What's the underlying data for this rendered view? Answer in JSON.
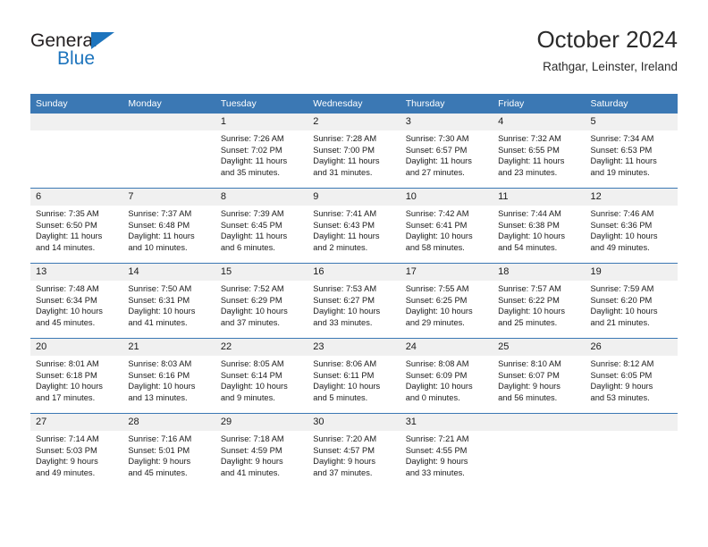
{
  "brand": {
    "name_top": "General",
    "name_bottom": "Blue",
    "accent_color": "#1d74bd"
  },
  "header": {
    "title": "October 2024",
    "subtitle": "Rathgar, Leinster, Ireland"
  },
  "calendar": {
    "header_bg": "#3b78b4",
    "daynum_bg": "#f0f0f0",
    "weekdays": [
      "Sunday",
      "Monday",
      "Tuesday",
      "Wednesday",
      "Thursday",
      "Friday",
      "Saturday"
    ],
    "weeks": [
      [
        {
          "day": "",
          "sunrise": "",
          "sunset": "",
          "daylight1": "",
          "daylight2": ""
        },
        {
          "day": "",
          "sunrise": "",
          "sunset": "",
          "daylight1": "",
          "daylight2": ""
        },
        {
          "day": "1",
          "sunrise": "Sunrise: 7:26 AM",
          "sunset": "Sunset: 7:02 PM",
          "daylight1": "Daylight: 11 hours",
          "daylight2": "and 35 minutes."
        },
        {
          "day": "2",
          "sunrise": "Sunrise: 7:28 AM",
          "sunset": "Sunset: 7:00 PM",
          "daylight1": "Daylight: 11 hours",
          "daylight2": "and 31 minutes."
        },
        {
          "day": "3",
          "sunrise": "Sunrise: 7:30 AM",
          "sunset": "Sunset: 6:57 PM",
          "daylight1": "Daylight: 11 hours",
          "daylight2": "and 27 minutes."
        },
        {
          "day": "4",
          "sunrise": "Sunrise: 7:32 AM",
          "sunset": "Sunset: 6:55 PM",
          "daylight1": "Daylight: 11 hours",
          "daylight2": "and 23 minutes."
        },
        {
          "day": "5",
          "sunrise": "Sunrise: 7:34 AM",
          "sunset": "Sunset: 6:53 PM",
          "daylight1": "Daylight: 11 hours",
          "daylight2": "and 19 minutes."
        }
      ],
      [
        {
          "day": "6",
          "sunrise": "Sunrise: 7:35 AM",
          "sunset": "Sunset: 6:50 PM",
          "daylight1": "Daylight: 11 hours",
          "daylight2": "and 14 minutes."
        },
        {
          "day": "7",
          "sunrise": "Sunrise: 7:37 AM",
          "sunset": "Sunset: 6:48 PM",
          "daylight1": "Daylight: 11 hours",
          "daylight2": "and 10 minutes."
        },
        {
          "day": "8",
          "sunrise": "Sunrise: 7:39 AM",
          "sunset": "Sunset: 6:45 PM",
          "daylight1": "Daylight: 11 hours",
          "daylight2": "and 6 minutes."
        },
        {
          "day": "9",
          "sunrise": "Sunrise: 7:41 AM",
          "sunset": "Sunset: 6:43 PM",
          "daylight1": "Daylight: 11 hours",
          "daylight2": "and 2 minutes."
        },
        {
          "day": "10",
          "sunrise": "Sunrise: 7:42 AM",
          "sunset": "Sunset: 6:41 PM",
          "daylight1": "Daylight: 10 hours",
          "daylight2": "and 58 minutes."
        },
        {
          "day": "11",
          "sunrise": "Sunrise: 7:44 AM",
          "sunset": "Sunset: 6:38 PM",
          "daylight1": "Daylight: 10 hours",
          "daylight2": "and 54 minutes."
        },
        {
          "day": "12",
          "sunrise": "Sunrise: 7:46 AM",
          "sunset": "Sunset: 6:36 PM",
          "daylight1": "Daylight: 10 hours",
          "daylight2": "and 49 minutes."
        }
      ],
      [
        {
          "day": "13",
          "sunrise": "Sunrise: 7:48 AM",
          "sunset": "Sunset: 6:34 PM",
          "daylight1": "Daylight: 10 hours",
          "daylight2": "and 45 minutes."
        },
        {
          "day": "14",
          "sunrise": "Sunrise: 7:50 AM",
          "sunset": "Sunset: 6:31 PM",
          "daylight1": "Daylight: 10 hours",
          "daylight2": "and 41 minutes."
        },
        {
          "day": "15",
          "sunrise": "Sunrise: 7:52 AM",
          "sunset": "Sunset: 6:29 PM",
          "daylight1": "Daylight: 10 hours",
          "daylight2": "and 37 minutes."
        },
        {
          "day": "16",
          "sunrise": "Sunrise: 7:53 AM",
          "sunset": "Sunset: 6:27 PM",
          "daylight1": "Daylight: 10 hours",
          "daylight2": "and 33 minutes."
        },
        {
          "day": "17",
          "sunrise": "Sunrise: 7:55 AM",
          "sunset": "Sunset: 6:25 PM",
          "daylight1": "Daylight: 10 hours",
          "daylight2": "and 29 minutes."
        },
        {
          "day": "18",
          "sunrise": "Sunrise: 7:57 AM",
          "sunset": "Sunset: 6:22 PM",
          "daylight1": "Daylight: 10 hours",
          "daylight2": "and 25 minutes."
        },
        {
          "day": "19",
          "sunrise": "Sunrise: 7:59 AM",
          "sunset": "Sunset: 6:20 PM",
          "daylight1": "Daylight: 10 hours",
          "daylight2": "and 21 minutes."
        }
      ],
      [
        {
          "day": "20",
          "sunrise": "Sunrise: 8:01 AM",
          "sunset": "Sunset: 6:18 PM",
          "daylight1": "Daylight: 10 hours",
          "daylight2": "and 17 minutes."
        },
        {
          "day": "21",
          "sunrise": "Sunrise: 8:03 AM",
          "sunset": "Sunset: 6:16 PM",
          "daylight1": "Daylight: 10 hours",
          "daylight2": "and 13 minutes."
        },
        {
          "day": "22",
          "sunrise": "Sunrise: 8:05 AM",
          "sunset": "Sunset: 6:14 PM",
          "daylight1": "Daylight: 10 hours",
          "daylight2": "and 9 minutes."
        },
        {
          "day": "23",
          "sunrise": "Sunrise: 8:06 AM",
          "sunset": "Sunset: 6:11 PM",
          "daylight1": "Daylight: 10 hours",
          "daylight2": "and 5 minutes."
        },
        {
          "day": "24",
          "sunrise": "Sunrise: 8:08 AM",
          "sunset": "Sunset: 6:09 PM",
          "daylight1": "Daylight: 10 hours",
          "daylight2": "and 0 minutes."
        },
        {
          "day": "25",
          "sunrise": "Sunrise: 8:10 AM",
          "sunset": "Sunset: 6:07 PM",
          "daylight1": "Daylight: 9 hours",
          "daylight2": "and 56 minutes."
        },
        {
          "day": "26",
          "sunrise": "Sunrise: 8:12 AM",
          "sunset": "Sunset: 6:05 PM",
          "daylight1": "Daylight: 9 hours",
          "daylight2": "and 53 minutes."
        }
      ],
      [
        {
          "day": "27",
          "sunrise": "Sunrise: 7:14 AM",
          "sunset": "Sunset: 5:03 PM",
          "daylight1": "Daylight: 9 hours",
          "daylight2": "and 49 minutes."
        },
        {
          "day": "28",
          "sunrise": "Sunrise: 7:16 AM",
          "sunset": "Sunset: 5:01 PM",
          "daylight1": "Daylight: 9 hours",
          "daylight2": "and 45 minutes."
        },
        {
          "day": "29",
          "sunrise": "Sunrise: 7:18 AM",
          "sunset": "Sunset: 4:59 PM",
          "daylight1": "Daylight: 9 hours",
          "daylight2": "and 41 minutes."
        },
        {
          "day": "30",
          "sunrise": "Sunrise: 7:20 AM",
          "sunset": "Sunset: 4:57 PM",
          "daylight1": "Daylight: 9 hours",
          "daylight2": "and 37 minutes."
        },
        {
          "day": "31",
          "sunrise": "Sunrise: 7:21 AM",
          "sunset": "Sunset: 4:55 PM",
          "daylight1": "Daylight: 9 hours",
          "daylight2": "and 33 minutes."
        },
        {
          "day": "",
          "sunrise": "",
          "sunset": "",
          "daylight1": "",
          "daylight2": ""
        },
        {
          "day": "",
          "sunrise": "",
          "sunset": "",
          "daylight1": "",
          "daylight2": ""
        }
      ]
    ]
  }
}
